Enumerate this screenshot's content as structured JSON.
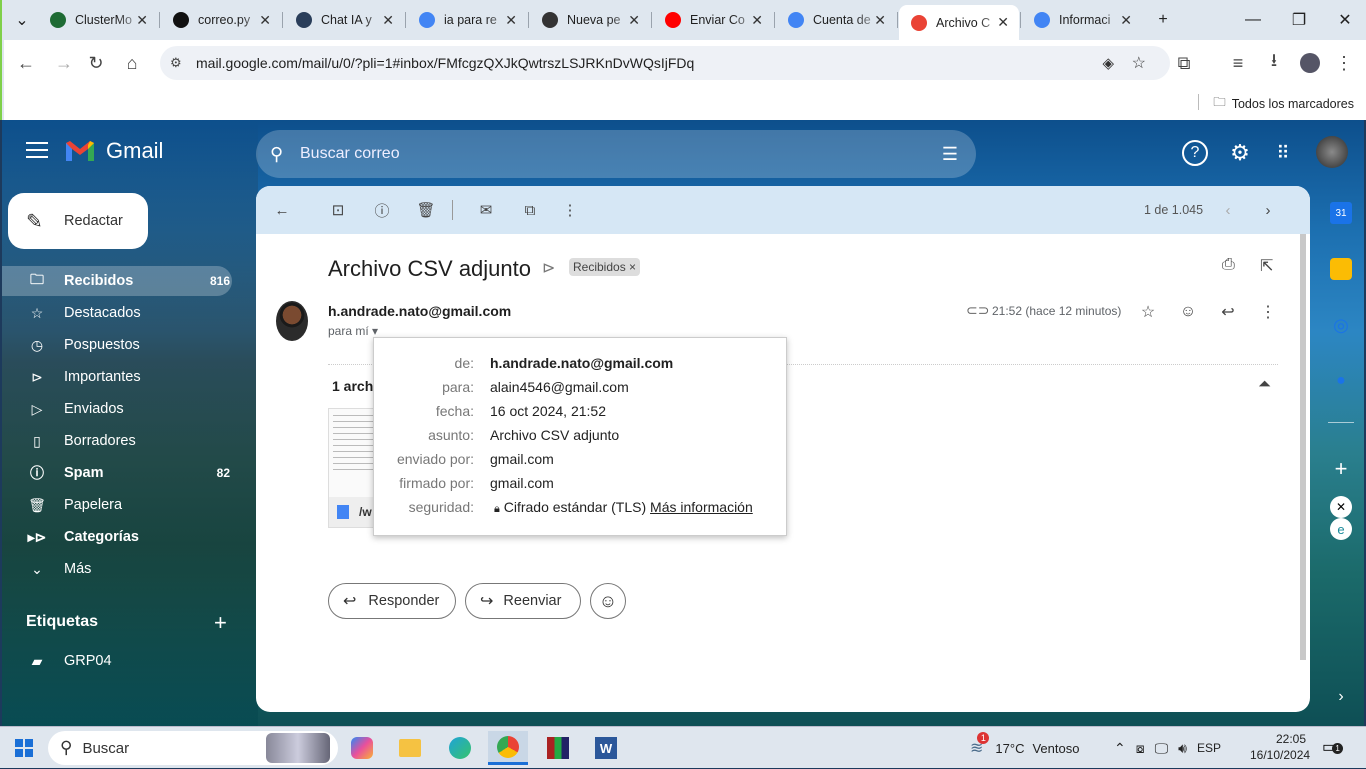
{
  "browser": {
    "tabs": [
      {
        "title": "ClusterMo",
        "icon": "mongodb-icon",
        "color": "#1e6b34"
      },
      {
        "title": "correo.py",
        "icon": "github-icon",
        "color": "#111111"
      },
      {
        "title": "Chat IA y",
        "icon": "chat-ai-icon",
        "color": "#2a3e5a"
      },
      {
        "title": "ia para re",
        "icon": "google-icon",
        "color": "#4285f4"
      },
      {
        "title": "Nueva pe",
        "icon": "chatgpt-icon",
        "color": "#333333"
      },
      {
        "title": "Enviar Co",
        "icon": "youtube-icon",
        "color": "#ff0000"
      },
      {
        "title": "Cuenta de",
        "icon": "google-icon",
        "color": "#4285f4"
      },
      {
        "title": "Archivo C",
        "icon": "gmail-icon",
        "color": "#ea4335"
      },
      {
        "title": "Informaci",
        "icon": "google-icon",
        "color": "#4285f4"
      }
    ],
    "url": "mail.google.com/mail/u/0/?pli=1#inbox/FMfcgzQXJkQwtrszLSJRKnDvWQsIjFDq",
    "bookmarks_label": "Todos los marcadores"
  },
  "gmail": {
    "brand": "Gmail",
    "search_placeholder": "Buscar correo",
    "compose_label": "Redactar",
    "nav": [
      {
        "label": "Recibidos",
        "count": "816",
        "icon": "inbox-icon",
        "selected": true,
        "bold": true
      },
      {
        "label": "Destacados",
        "count": "",
        "icon": "star-icon"
      },
      {
        "label": "Pospuestos",
        "count": "",
        "icon": "clock-icon"
      },
      {
        "label": "Importantes",
        "count": "",
        "icon": "label-important-icon"
      },
      {
        "label": "Enviados",
        "count": "",
        "icon": "send-icon"
      },
      {
        "label": "Borradores",
        "count": "",
        "icon": "draft-icon"
      },
      {
        "label": "Spam",
        "count": "82",
        "icon": "spam-icon",
        "bold": true
      },
      {
        "label": "Papelera",
        "count": "",
        "icon": "trash-icon"
      },
      {
        "label": "Categorías",
        "count": "",
        "icon": "category-icon",
        "bold": true
      },
      {
        "label": "Más",
        "count": "",
        "icon": "chevron-down-icon"
      }
    ],
    "labels_heading": "Etiquetas",
    "labels": [
      {
        "label": "GRP04",
        "icon": "tag-icon"
      }
    ],
    "pagination": "1 de 1.045",
    "message": {
      "subject": "Archivo CSV adjunto",
      "chip": "Recibidos",
      "sender": "h.andrade.nato@gmail.com",
      "to_me": "para mí",
      "time": "21:52 (hace 12 minutos)",
      "attachment_heading": "1 arch",
      "attachment_name": "/w"
    },
    "details": {
      "from_key": "de:",
      "from_val": "h.andrade.nato@gmail.com",
      "to_key": "para:",
      "to_val": "alain4546@gmail.com",
      "date_key": "fecha:",
      "date_val": "16 oct 2024, 21:52",
      "subject_key": "asunto:",
      "subject_val": "Archivo CSV adjunto",
      "mailedby_key": "enviado por:",
      "mailedby_val": "gmail.com",
      "signedby_key": "firmado por:",
      "signedby_val": "gmail.com",
      "security_key": "seguridad:",
      "security_val": "Cifrado estándar (TLS)",
      "security_link": "Más información"
    },
    "reply_label": "Responder",
    "forward_label": "Reenviar"
  },
  "taskbar": {
    "search_label": "Buscar",
    "weather": "17°C",
    "weather_desc": "Ventoso",
    "weather_badge": "1",
    "lang": "ESP",
    "time": "22:05",
    "date": "16/10/2024",
    "notification_badge": "1"
  }
}
